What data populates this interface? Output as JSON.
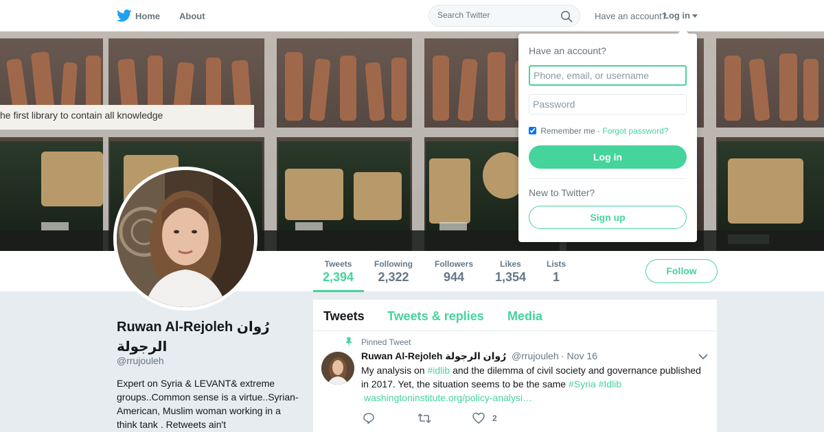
{
  "colors": {
    "accent": "#45d49b",
    "brand_bird": "#1da1f2",
    "text_muted": "#657786",
    "page_bg": "#e6ecf0"
  },
  "nav": {
    "logo_icon": "twitter-bird-icon",
    "home_label": "Home",
    "about_label": "About",
    "search_placeholder": "Search Twitter",
    "have_account": "Have an account?",
    "login_label": "Log in"
  },
  "banner": {
    "sign_text": "he first library to contain all knowledge"
  },
  "login_dropdown": {
    "title": "Have an account?",
    "username_placeholder": "Phone, email, or username",
    "password_placeholder": "Password",
    "remember_label": "Remember me",
    "separator": "·",
    "forgot_label": "Forgot password?",
    "login_button": "Log in",
    "new_to_twitter": "New to Twitter?",
    "signup_button": "Sign up"
  },
  "stats": [
    {
      "label": "Tweets",
      "value": "2,394"
    },
    {
      "label": "Following",
      "value": "2,322"
    },
    {
      "label": "Followers",
      "value": "944"
    },
    {
      "label": "Likes",
      "value": "1,354"
    },
    {
      "label": "Lists",
      "value": "1"
    }
  ],
  "follow_button": "Follow",
  "profile": {
    "name": "Ruwan Al-Rejoleh رُوان الرجولة",
    "handle": "@rrujouleh",
    "bio": "Expert on Syria & LEVANT& extreme groups..Common sense is a virtue..Syrian- American, Muslim woman working in a think tank . Retweets ain't"
  },
  "timeline": {
    "tabs": [
      "Tweets",
      "Tweets & replies",
      "Media"
    ],
    "pinned_label": "Pinned Tweet",
    "tweet": {
      "name": "Ruwan Al-Rejoleh رُوان الرجولة",
      "handle": "@rrujouleh",
      "date": "· Nov 16",
      "text_1": "My analysis on ",
      "hashtag_1": "#idlib",
      "text_2": " and the dilemma of civil society and governance published in 2017. Yet, the situation seems to be the same ",
      "hashtag_2": "#Syria",
      "hashtag_3": "#Idlib",
      "link": "washingtoninstitute.org/policy-analysi…",
      "like_count": "2"
    }
  }
}
